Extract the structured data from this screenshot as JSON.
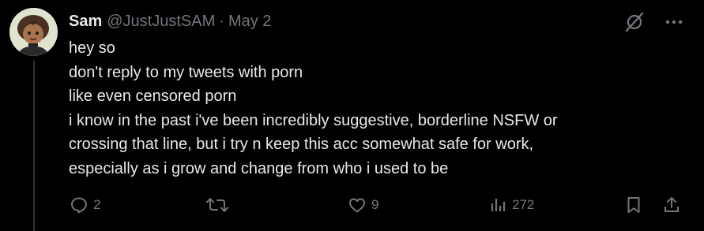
{
  "tweet": {
    "display_name": "Sam",
    "handle": "@JustJustSAM",
    "separator": "·",
    "date": "May 2",
    "lines": [
      "hey so",
      "don't reply to my tweets with porn",
      "like even censored porn",
      "i know in the past i've been incredibly suggestive, borderline NSFW or",
      "crossing that line, but i try n keep this acc somewhat safe for work,",
      "especially as i grow and change from who i used to be"
    ],
    "counts": {
      "replies": "2",
      "likes": "9",
      "views": "272"
    }
  },
  "icons": {
    "top": [
      "grok-slash-icon",
      "more-options-icon"
    ],
    "actions": [
      "reply-icon",
      "retweet-icon",
      "like-icon",
      "views-icon",
      "bookmark-icon",
      "share-icon"
    ]
  },
  "colors": {
    "background": "#000000",
    "text_primary": "#e7e9ea",
    "text_secondary": "#71767b",
    "thread_line": "#333639"
  }
}
